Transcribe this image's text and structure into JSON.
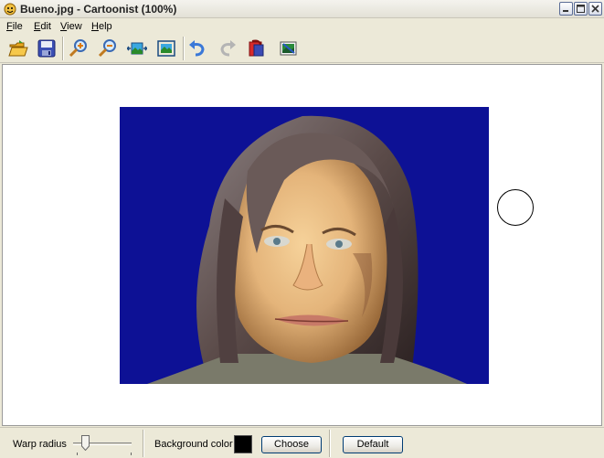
{
  "window": {
    "title": "Bueno.jpg - Cartoonist (100%)"
  },
  "menu": [
    {
      "label": "File",
      "accel": "F",
      "rest": "ile"
    },
    {
      "label": "Edit",
      "accel": "E",
      "rest": "dit"
    },
    {
      "label": "View",
      "accel": "V",
      "rest": "iew"
    },
    {
      "label": "Help",
      "accel": "H",
      "rest": "elp"
    }
  ],
  "toolbar": {
    "buttons": [
      "open-icon",
      "save-icon",
      "zoom-in-icon",
      "zoom-out-icon",
      "fit-width-icon",
      "fit-window-icon",
      "undo-icon",
      "redo-icon",
      "reset-icon",
      "background-image-icon"
    ]
  },
  "canvas": {
    "image_description_visible": "cartoon-warped face of a long-haired man on blue background",
    "background_color": "#0d1195"
  },
  "bottom": {
    "warp_radius_label": "Warp radius",
    "warp_radius_value": 0.2,
    "background_color_label": "Background color",
    "background_color_value": "#000000",
    "choose_label": "Choose",
    "default_label": "Default"
  }
}
